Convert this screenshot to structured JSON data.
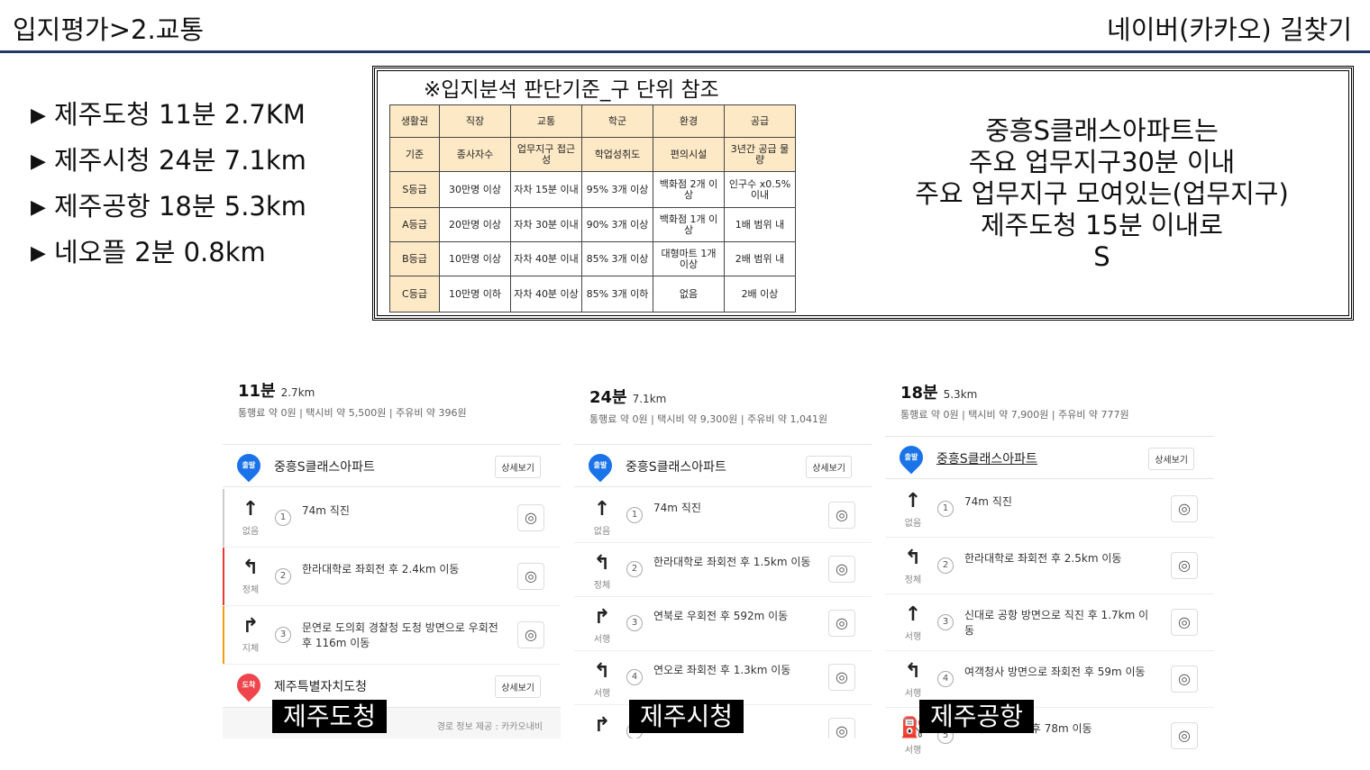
{
  "header": {
    "title": "입지평가>2.교통",
    "right": "네이버(카카오) 길찾기"
  },
  "bullets": [
    "제주도청 11분 2.7KM",
    "제주시청 24분 7.1km",
    "제주공항 18분 5.3km",
    "네오플 2분 0.8km"
  ],
  "criteria": {
    "title": "※입지분석 판단기준_구 단위 참조",
    "header": [
      "생활권",
      "직장",
      "교통",
      "학군",
      "환경",
      "공급"
    ],
    "rows": [
      [
        "기준",
        "종사자수",
        "업무지구 접근성",
        "학업성취도",
        "편의시설",
        "3년간 공급 물량"
      ],
      [
        "S등급",
        "30만명 이상",
        "자차 15분 이내",
        "95% 3개 이상",
        "백화점 2개 이상",
        "인구수 x0.5% 이내"
      ],
      [
        "A등급",
        "20만명 이상",
        "자차 30분 이내",
        "90% 3개 이상",
        "백화점 1개 이상",
        "1배 범위 내"
      ],
      [
        "B등급",
        "10만명 이상",
        "자차 40분 이내",
        "85% 3개 이상",
        "대형마트 1개 이상",
        "2배 범위 내"
      ],
      [
        "C등급",
        "10만명 이하",
        "자차 40분 이상",
        "85% 3개 이하",
        "없음",
        "2배 이상"
      ]
    ]
  },
  "summary": {
    "l1": "중흥S클래스아파트는",
    "l2": "주요 업무지구30분 이내",
    "l3": "주요 업무지구 모여있는(업무지구)",
    "l4": "제주도청 15분 이내로",
    "l5": "S"
  },
  "panels": [
    {
      "time": "11분",
      "dist": "2.7km",
      "fee": "통행료 약 0원  |  택시비 약 5,500원  |  주유비 약 396원",
      "start": "중흥S클래스아파트",
      "start_badge": "출발",
      "detail": "상세보기",
      "steps": [
        {
          "arrow": "↑",
          "status": "없음",
          "num": "1",
          "text": "74m 직진",
          "color": "#ccc"
        },
        {
          "arrow": "↰",
          "status": "정체",
          "num": "2",
          "text": "한라대학로 좌회전 후 2.4km 이동",
          "color": "#e53935"
        },
        {
          "arrow": "↱",
          "status": "지체",
          "num": "3",
          "text": "문연로 도의회 경찰청 도청 방면으로 우회전 후 116m 이동",
          "color": "#f39c12"
        }
      ],
      "end": "제주특별자치도청",
      "end_badge": "도착",
      "credit": "경로 정보 제공 : 카카오내비",
      "label": "제주도청"
    },
    {
      "time": "24분",
      "dist": "7.1km",
      "fee": "통행료 약 0원  |  택시비 약 9,300원  |  주유비 약 1,041원",
      "start": "중흥S클래스아파트",
      "start_badge": "출발",
      "detail": "상세보기",
      "steps": [
        {
          "arrow": "↑",
          "status": "없음",
          "num": "1",
          "text": "74m 직진"
        },
        {
          "arrow": "↰",
          "status": "정체",
          "num": "2",
          "text": "한라대학로 좌회전 후 1.5km 이동"
        },
        {
          "arrow": "↱",
          "status": "서행",
          "num": "3",
          "text": "연북로 우회전 후 592m 이동"
        },
        {
          "arrow": "↰",
          "status": "서행",
          "num": "4",
          "text": "연오로 좌회전 후 1.3km 이동"
        },
        {
          "arrow": "↱",
          "status": "",
          "num": "5",
          "text": "이동"
        }
      ],
      "label": "제주시청"
    },
    {
      "time": "18분",
      "dist": "5.3km",
      "fee": "통행료 약 0원  |  택시비 약 7,900원  |  주유비 약 777원",
      "start": "중흥S클래스아파트",
      "start_badge": "출발",
      "detail": "상세보기",
      "steps": [
        {
          "arrow": "↑",
          "status": "없음",
          "num": "1",
          "text": "74m 직진"
        },
        {
          "arrow": "↰",
          "status": "정체",
          "num": "2",
          "text": "한라대학로 좌회전 후 2.5km 이동"
        },
        {
          "arrow": "↑",
          "status": "서행",
          "num": "3",
          "text": "신대로 공항 방면으로 직진 후 1.7km 이동"
        },
        {
          "arrow": "↰",
          "status": "서행",
          "num": "4",
          "text": "여객청사 방면으로 좌회전 후 59m 이동"
        },
        {
          "arrow": "⛽",
          "status": "서행",
          "num": "5",
          "text": "고가도로 진입 후 78m 이동"
        }
      ],
      "label": "제주공항"
    }
  ]
}
